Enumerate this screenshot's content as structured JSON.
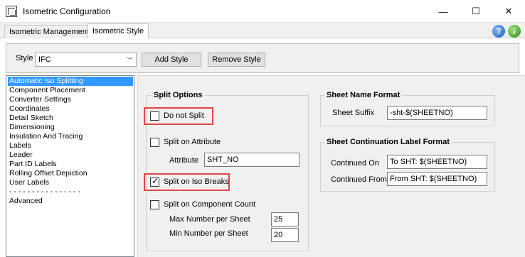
{
  "window": {
    "title": "Isometric Configuration",
    "minimize_glyph": "—",
    "maximize_glyph": "☐",
    "close_glyph": "✕"
  },
  "tabs": [
    {
      "label": "Isometric Management",
      "active": false
    },
    {
      "label": "Isometric Style",
      "active": true
    }
  ],
  "help": {
    "help_glyph": "?",
    "info_glyph": "i"
  },
  "style_bar": {
    "label": "Style",
    "selected": "IFC",
    "add_label": "Add Style",
    "remove_label": "Remove Style"
  },
  "categories": [
    {
      "label": "Automatic Iso Splitting",
      "selected": true
    },
    {
      "label": "Component Placement"
    },
    {
      "label": "Converter Settings"
    },
    {
      "label": "Coordinates"
    },
    {
      "label": "Detail Sketch"
    },
    {
      "label": "Dimensioning"
    },
    {
      "label": "Insulation And Tracing"
    },
    {
      "label": "Labels"
    },
    {
      "label": "Leader"
    },
    {
      "label": "Part ID Labels"
    },
    {
      "label": "Rolling Offset Depiction"
    },
    {
      "label": "User Labels"
    },
    {
      "label": "- - - - - - - - - - - - - - - -"
    },
    {
      "label": "Advanced"
    }
  ],
  "split_options": {
    "title": "Split Options",
    "do_not_split": {
      "label": "Do not Split",
      "checked": false
    },
    "split_on_attribute": {
      "label": "Split on Attribute",
      "checked": false
    },
    "attribute_label": "Attribute",
    "attribute_value": "SHT_NO",
    "split_on_iso_breaks": {
      "label": "Split on Iso Breaks",
      "checked": true
    },
    "split_on_component_count": {
      "label": "Split on Component Count",
      "checked": false
    },
    "max_label": "Max Number per Sheet",
    "max_value": "25",
    "min_label": "Min Number per Sheet",
    "min_value": "20"
  },
  "sheet_name_format": {
    "title": "Sheet Name Format",
    "suffix_label": "Sheet Suffix",
    "suffix_value": "-sht-$(SHEETNO)"
  },
  "continuation": {
    "title": "Sheet Continuation Label Format",
    "on_label": "Continued On",
    "on_value": "To SHT: $(SHEETNO)",
    "from_label": "Continued From",
    "from_value": "From SHT: $(SHEETNO)"
  },
  "colors": {
    "highlight": "#e04646",
    "selection": "#3399ff"
  }
}
